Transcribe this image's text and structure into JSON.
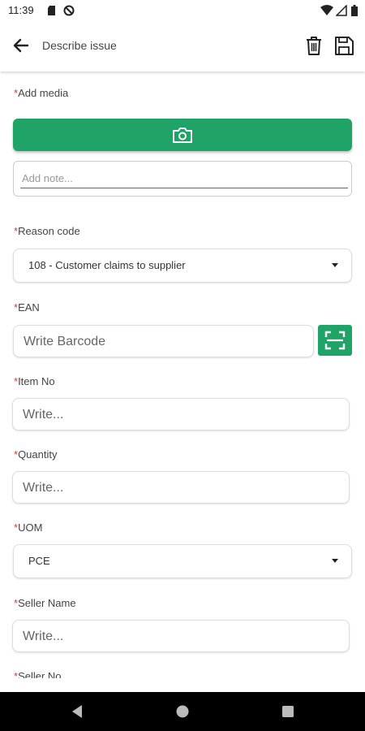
{
  "status_bar": {
    "time": "11:39",
    "icons": [
      "sd-card-icon",
      "do-not-disturb-icon",
      "wifi-icon",
      "signal-icon",
      "battery-icon"
    ]
  },
  "app_bar": {
    "title": "Describe issue",
    "back_icon": "arrow-left-icon",
    "delete_icon": "trash-icon",
    "save_icon": "floppy-disk-icon"
  },
  "form": {
    "required_marker": "*",
    "media": {
      "label": "Add media",
      "button_icon": "camera-icon",
      "note_placeholder": "Add note..."
    },
    "reason_code": {
      "label": "Reason code",
      "value": "108 - Customer claims to supplier"
    },
    "ean": {
      "label": "EAN",
      "placeholder": "Write Barcode",
      "scan_icon": "barcode-scan-icon"
    },
    "item_no": {
      "label": "Item No",
      "placeholder": "Write..."
    },
    "quantity": {
      "label": "Quantity",
      "placeholder": "Write..."
    },
    "uom": {
      "label": "UOM",
      "value": "PCE"
    },
    "seller_name": {
      "label": "Seller Name",
      "placeholder": "Write..."
    },
    "seller_no": {
      "label": "Seller No"
    }
  },
  "colors": {
    "accent": "#1fa366",
    "required": "#e53935"
  },
  "nav_bar": {
    "icons": [
      "back-triangle-icon",
      "home-circle-icon",
      "recents-square-icon"
    ]
  }
}
